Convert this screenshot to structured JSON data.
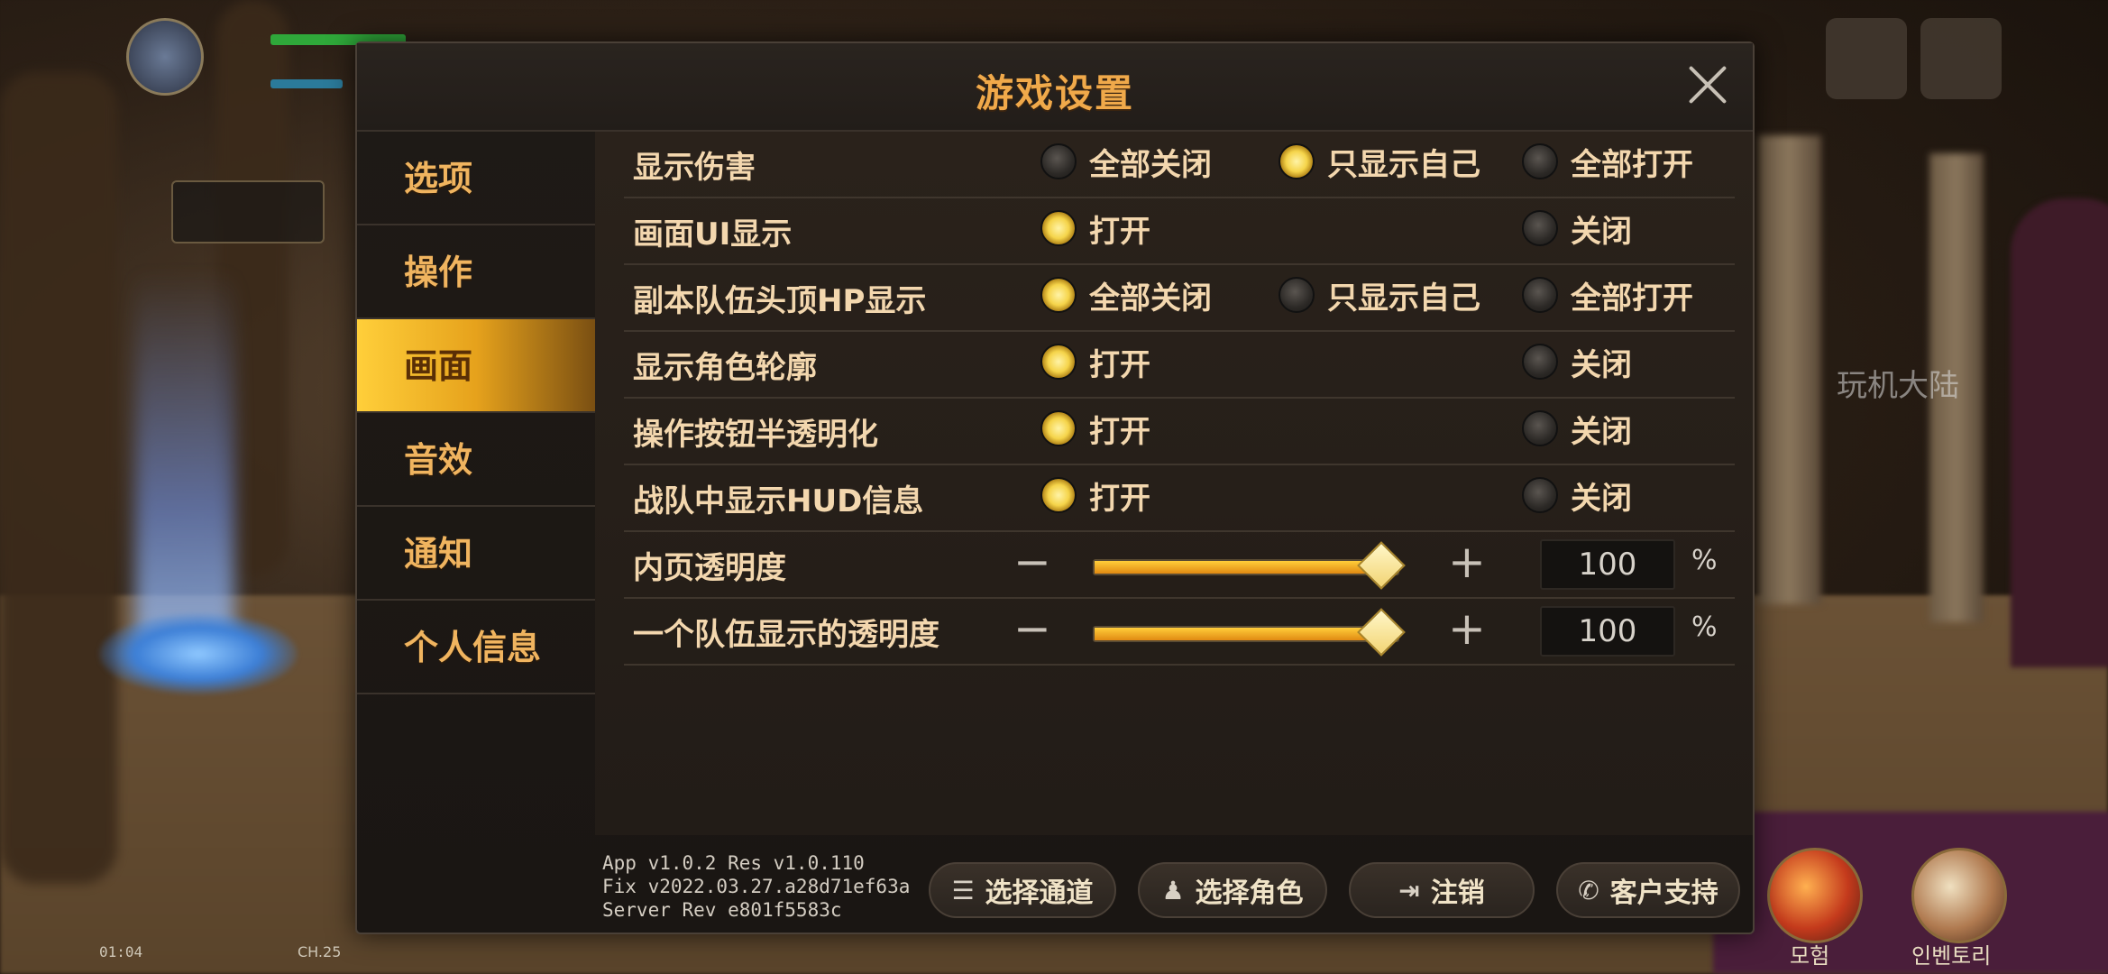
{
  "hud": {
    "clock": "01:04",
    "channel": "CH.25",
    "side_tag": "玩机大陆",
    "bottom_labels": [
      "모험",
      "인벤토리"
    ]
  },
  "dialog": {
    "title": "游戏设置",
    "sidebar": [
      "选项",
      "操作",
      "画面",
      "音效",
      "通知",
      "个人信息"
    ],
    "active_tab": "画面",
    "settings": [
      {
        "label": "显示伤害",
        "options": [
          "全部关闭",
          "只显示自己",
          "全部打开"
        ],
        "selected": 1
      },
      {
        "label": "画面UI显示",
        "options": [
          "打开",
          "关闭"
        ],
        "selected": 0
      },
      {
        "label": "副本队伍头顶HP显示",
        "options": [
          "全部关闭",
          "只显示自己",
          "全部打开"
        ],
        "selected": 0
      },
      {
        "label": "显示角色轮廓",
        "options": [
          "打开",
          "关闭"
        ],
        "selected": 0
      },
      {
        "label": "操作按钮半透明化",
        "options": [
          "打开",
          "关闭"
        ],
        "selected": 0
      },
      {
        "label": "战队中显示HUD信息",
        "options": [
          "打开",
          "关闭"
        ],
        "selected": 0
      }
    ],
    "sliders": [
      {
        "label": "内页透明度",
        "value": "100",
        "fraction": 1.0,
        "minus": "−",
        "plus": "+",
        "unit": "%"
      },
      {
        "label": "一个队伍显示的透明度",
        "value": "100",
        "fraction": 1.0,
        "minus": "−",
        "plus": "+",
        "unit": "%"
      }
    ],
    "version": {
      "line1": "App v1.0.2 Res v1.0.110",
      "line2": "Fix v2022.03.27.a28d71ef63a",
      "line3": "Server Rev e801f5583c"
    },
    "footer_buttons": [
      {
        "label": "选择通道",
        "icon": "list-icon"
      },
      {
        "label": "选择角色",
        "icon": "character-icon"
      },
      {
        "label": "注销",
        "icon": "logout-icon"
      },
      {
        "label": "客户支持",
        "icon": "support-icon"
      }
    ]
  },
  "colors": {
    "title": "#f0a94a",
    "sidebar_text": "#f0b45f",
    "active_tab_bg": "#ffcf3a",
    "option_text": "#f3d7ae",
    "radio_on": "#f5d44a",
    "slider_fill": "#e18a12"
  }
}
